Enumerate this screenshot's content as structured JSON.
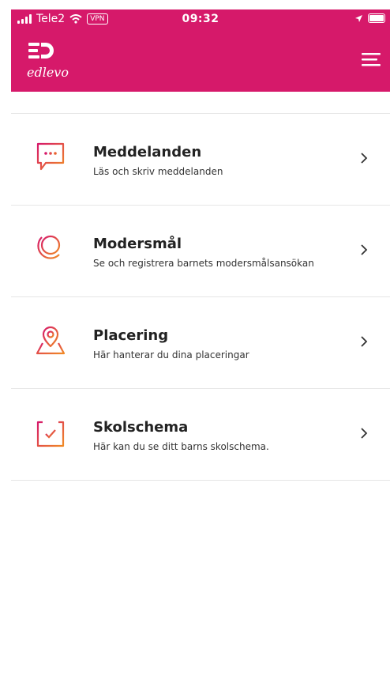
{
  "status_bar": {
    "carrier": "Tele2",
    "vpn": "VPN",
    "time": "09:32"
  },
  "header": {
    "logo_text": "edlevo",
    "background_color": "#D6196A"
  },
  "menu": {
    "items": [
      {
        "title": "Meddelanden",
        "subtitle": "Läs och skriv meddelanden",
        "icon": "chat-bubble-icon"
      },
      {
        "title": "Modersmål",
        "subtitle": "Se och registrera barnets modersmålsansökan",
        "icon": "globe-icon"
      },
      {
        "title": "Placering",
        "subtitle": "Här hanterar du dina placeringar",
        "icon": "map-pin-icon"
      },
      {
        "title": "Skolschema",
        "subtitle": "Här kan du se ditt barns skolschema.",
        "icon": "calendar-check-icon"
      }
    ]
  },
  "colors": {
    "icon_gradient_start": "#D6196A",
    "icon_gradient_end": "#F08A24"
  }
}
